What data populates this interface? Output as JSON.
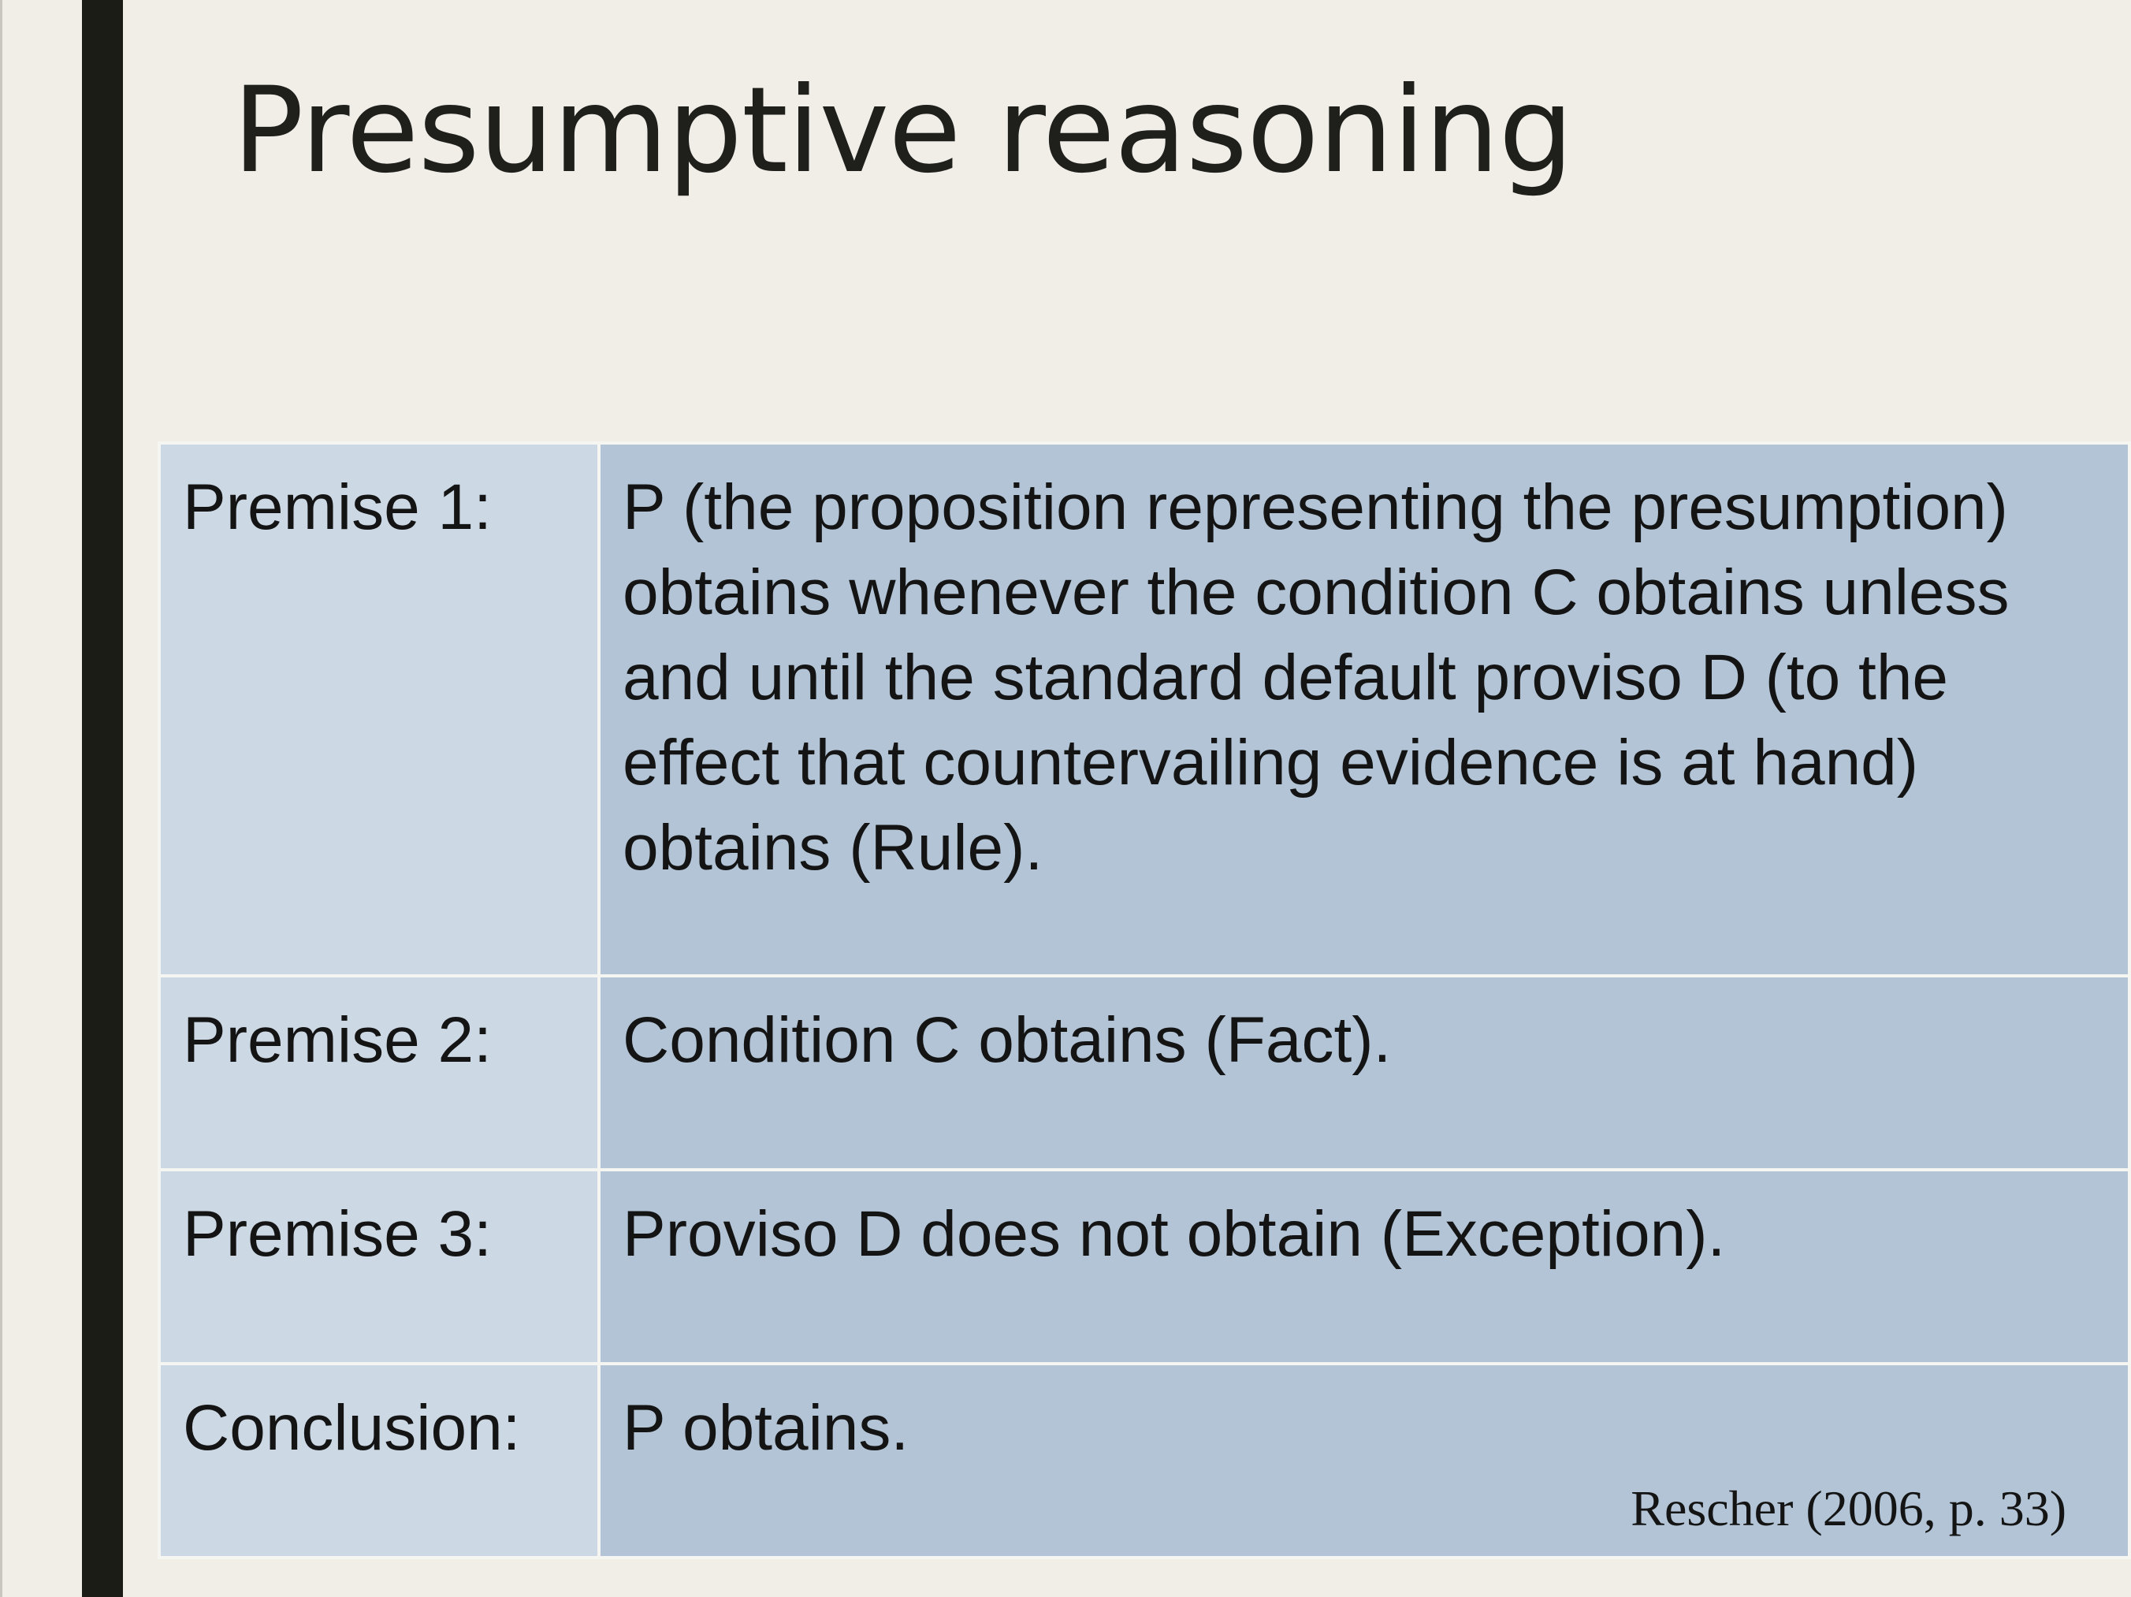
{
  "slide": {
    "title": "Presumptive reasoning",
    "rows": [
      {
        "label": "Premise 1:",
        "text": "P (the proposition representing the presumption) obtains whenever the condition C obtains unless and until the standard default proviso D (to the effect that countervailing evidence is at hand) obtains (Rule)."
      },
      {
        "label": "Premise 2:",
        "text": "Condition C obtains (Fact)."
      },
      {
        "label": "Premise 3:",
        "text": "Proviso D does not obtain (Exception)."
      },
      {
        "label": "Conclusion:",
        "text": "P obtains."
      }
    ],
    "citation": "Rescher (2006, p. 33)"
  },
  "colors": {
    "background": "#f1eee8",
    "accent_bar": "#1c1c17",
    "label_cell": "#ccd8e4",
    "text_cell": "#b2c4d5",
    "cell_border": "#f5f5f2"
  }
}
